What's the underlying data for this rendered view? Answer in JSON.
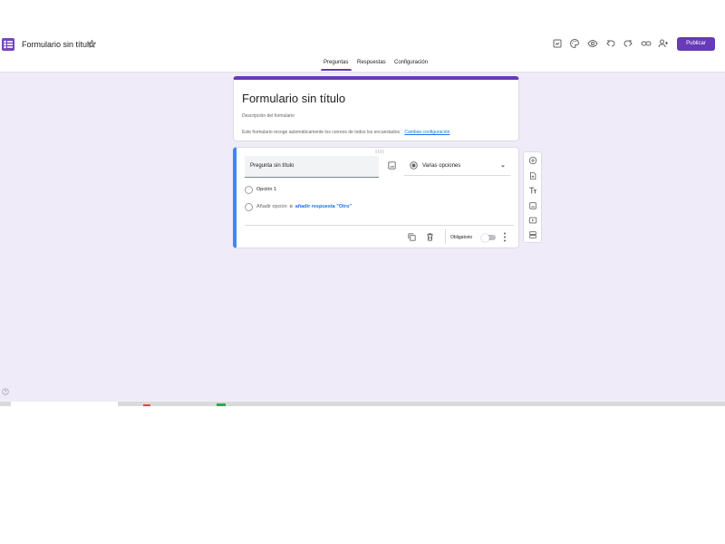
{
  "header": {
    "title": "Formulario sin título",
    "publish_label": "Publicar"
  },
  "tabs": [
    {
      "label": "Preguntas",
      "active": true
    },
    {
      "label": "Respuestas",
      "active": false
    },
    {
      "label": "Configuración",
      "active": false
    }
  ],
  "form": {
    "title": "Formulario sin título",
    "description_placeholder": "Descripción del formulario",
    "collect_note": "Este formulario recoge automáticamente los correos de todos los encuestados.",
    "collect_link": "Cambiar configuración"
  },
  "question": {
    "title_placeholder": "Pregunta sin título",
    "type_label": "Varias opciones",
    "option_1": "Opción 1",
    "add_option": "Añadir opción",
    "add_sep": "o",
    "add_other": "añadir respuesta \"Otro\"",
    "required_label": "Obligatorio",
    "required_on": false
  },
  "colors": {
    "accent": "#673ab7",
    "background": "#f0ebf8",
    "question_border": "#4285f4",
    "link": "#1a73e8"
  },
  "icons": {
    "toolbar": [
      "addon-icon",
      "palette-icon",
      "preview-icon",
      "undo-icon",
      "redo-icon",
      "link-icon",
      "add-collaborator-icon"
    ],
    "side_toolbar": [
      "add-question-icon",
      "import-questions-icon",
      "add-title-icon",
      "add-image-icon",
      "add-video-icon",
      "add-section-icon"
    ]
  }
}
